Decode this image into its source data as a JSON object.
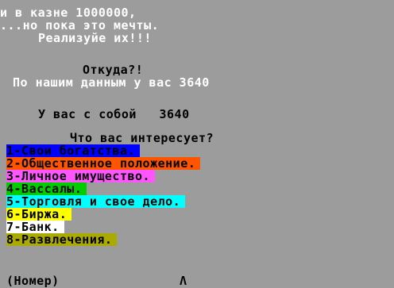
{
  "intro": {
    "line1": "и в казне 1000000,",
    "line2": "...но пока это мечты.",
    "line3": "Реализуйе их!!!"
  },
  "status": {
    "where": "Откуда?!",
    "data_line": "По нашим данным у вас 3640",
    "with_you": "У вас с собой   3640"
  },
  "menu": {
    "prompt": "Что вас интересует?",
    "items": [
      {
        "label": "1-Свои богатства.",
        "bg": "#0000ff",
        "fg": "#000000"
      },
      {
        "label": "2-Общественное положение.",
        "bg": "#ff5500",
        "fg": "#000000"
      },
      {
        "label": "3-Личное имущество.",
        "bg": "#ff55ff",
        "fg": "#000000"
      },
      {
        "label": "4-Вассалы.",
        "bg": "#00cc00",
        "fg": "#000000"
      },
      {
        "label": "5-Торговля и свое дело.",
        "bg": "#00ffff",
        "fg": "#000000"
      },
      {
        "label": "6-Биржа.",
        "bg": "#ffff00",
        "fg": "#000000"
      },
      {
        "label": "7-Банк.",
        "bg": "#ffffff",
        "fg": "#000000"
      },
      {
        "label": "8-Развлечения.",
        "bg": "#aaaa00",
        "fg": "#000000"
      }
    ]
  },
  "input": {
    "label": "(Номер)",
    "cursor": "Λ"
  },
  "colors": {
    "background": "#9c9c9c",
    "text_light": "#ffffff",
    "text_dark": "#000000"
  }
}
